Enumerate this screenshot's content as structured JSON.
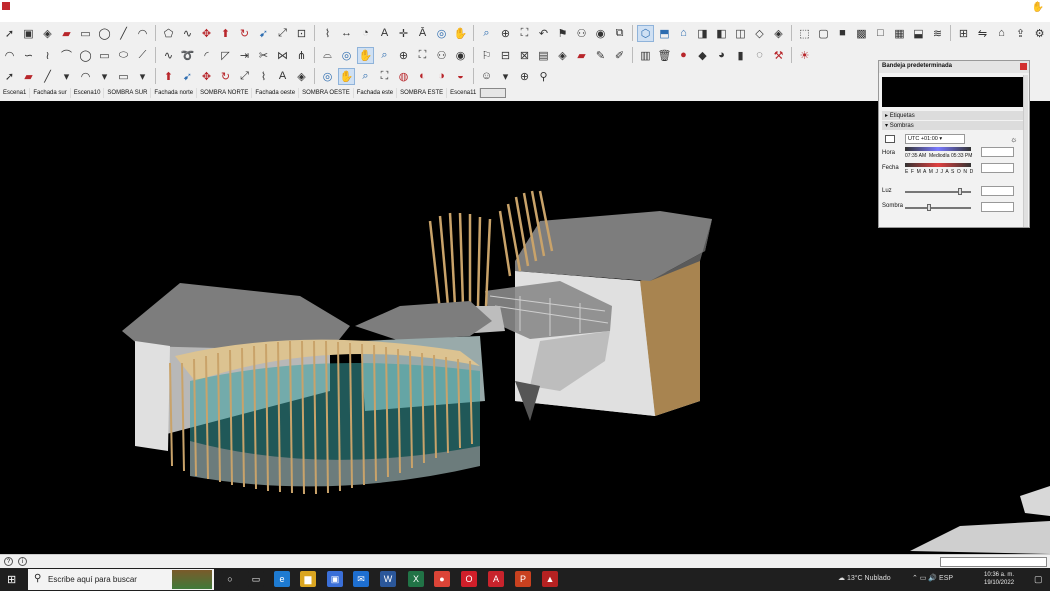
{
  "titlebar": {
    "title": "",
    "menu": "",
    "corner_icon": "hand-icon"
  },
  "toolbar1": {
    "icons": [
      "select-icon",
      "component-icon",
      "paint-icon",
      "eraser-icon",
      "rect-icon",
      "circle-icon",
      "line-icon",
      "arc-icon",
      "polygon-icon",
      "freehand-icon",
      "move-icon",
      "push-pull-icon",
      "rotate-icon",
      "follow-me-icon",
      "scale-icon",
      "offset-icon",
      "tape-icon",
      "dimension-icon",
      "protractor-icon",
      "text-icon",
      "axes-icon",
      "3d-text-icon",
      "orbit-icon",
      "pan-icon",
      "zoom-icon",
      "zoom-window-icon",
      "zoom-extents-icon",
      "previous-icon",
      "position-camera-icon",
      "walk-icon",
      "look-around-icon",
      "section-icon",
      "iso-view-icon",
      "top-view-icon",
      "front-view-icon",
      "right-view-icon",
      "back-view-icon",
      "left-view-icon",
      "xray-icon",
      "back-edges-icon",
      "wireframe-icon",
      "hidden-line-icon",
      "shaded-icon",
      "textured-icon",
      "monochrome-icon",
      "sandbox-icon",
      "stamp-icon",
      "drape-icon",
      "add-detail-icon",
      "flip-edge-icon",
      "warehouse-icon",
      "share-model-icon",
      "extension-icon"
    ]
  },
  "toolbar2": {
    "icons": [
      "arc-icon",
      "bezier-icon",
      "spline-icon",
      "curve-icon",
      "circle-icon",
      "rect-icon",
      "ellipse-icon",
      "polyline-icon",
      "wave-icon",
      "loop-icon",
      "fillet-icon",
      "chamfer-icon",
      "extend-icon",
      "trim-icon",
      "join-icon",
      "split-icon",
      "curve2-icon",
      "orbit-icon",
      "hand-icon",
      "zoom-icon",
      "zoom-window-icon",
      "zoom-extents-icon",
      "walk-icon",
      "look-around-icon",
      "position-icon",
      "section-plane-icon",
      "section-cut-icon",
      "display-icon",
      "paint-icon",
      "eraser-icon",
      "pencil-icon",
      "marker-icon",
      "layer-icon",
      "trash-icon",
      "sphere-icon",
      "shape-icon",
      "fill-icon",
      "solid-icon",
      "ghost-icon",
      "fix-icon",
      "light-icon"
    ]
  },
  "toolbar3": {
    "icons": [
      "select-icon",
      "eraser-icon",
      "line-icon",
      "dropdown-icon",
      "arc-icon",
      "dropdown-icon",
      "rect-icon",
      "dropdown-icon",
      "push-pull-icon",
      "follow-me-icon",
      "move-icon",
      "rotate-icon",
      "scale-icon",
      "tape-icon",
      "text-icon",
      "paint-icon",
      "orbit-icon",
      "pan-icon",
      "zoom-icon",
      "zoom-extents-icon",
      "scene-icon",
      "scene2-icon",
      "scene3-icon",
      "scene4-icon",
      "user-icon",
      "dropdown-icon",
      "compass-icon",
      "location-icon"
    ]
  },
  "scenes": {
    "tabs": [
      "Escena1",
      "Fachada sur",
      "Escena10",
      "SOMBRA SUR",
      "Fachada norte",
      "SOMBRA NORTE",
      "Fachada oeste",
      "SOMBRA OESTE",
      "Fachada este",
      "SOMBRA ESTE",
      "Escena11",
      ""
    ],
    "active_index": 11
  },
  "tray": {
    "title": "Bandeja predeterminada",
    "sections": [
      "Etiquetas",
      "Sombras"
    ],
    "timezone": "UTC +01:00",
    "hora_label": "Hora",
    "hora_start": "07:35 AM",
    "hora_mid": "Mediodía",
    "hora_end": "05:33 PM",
    "hora_value": "",
    "fecha_label": "Fecha",
    "months": "E F M A M J J A S O N D",
    "fecha_value": "",
    "luz_label": "Luz",
    "luz_value": "",
    "luz_level": 0.85,
    "sombra_label": "Sombra",
    "sombra_value": "",
    "sombra_level": 0.35
  },
  "taskbar": {
    "search_placeholder": "Escribe aquí para buscar",
    "weather": "13°C  Nublado",
    "language": "ESP",
    "time": "10:36 a. m.",
    "date": "19/10/2022",
    "apps": [
      {
        "name": "cortana-icon",
        "label": "○",
        "color": "#1f1f1f"
      },
      {
        "name": "task-view-icon",
        "label": "▭",
        "color": "#1f1f1f"
      },
      {
        "name": "edge-icon",
        "label": "e",
        "color": "#1e7bd1"
      },
      {
        "name": "explorer-icon",
        "label": "▆",
        "color": "#d9a520"
      },
      {
        "name": "store-icon",
        "label": "▣",
        "color": "#3a6fd8"
      },
      {
        "name": "mail-icon",
        "label": "✉",
        "color": "#1e6fd0"
      },
      {
        "name": "word-icon",
        "label": "W",
        "color": "#2b579a"
      },
      {
        "name": "excel-icon",
        "label": "X",
        "color": "#217346"
      },
      {
        "name": "chrome-icon",
        "label": "●",
        "color": "#db4437"
      },
      {
        "name": "opera-icon",
        "label": "O",
        "color": "#d01f2a"
      },
      {
        "name": "acrobat-icon",
        "label": "A",
        "color": "#c8232c"
      },
      {
        "name": "powerpoint-icon",
        "label": "P",
        "color": "#c9411f"
      },
      {
        "name": "sketchup-icon",
        "label": "▲",
        "color": "#b52222"
      }
    ]
  },
  "colors": {
    "viewport": "#000000",
    "roof": "#7d7d7d",
    "wood": "#c9a36a",
    "glass": "#3aa0a0",
    "wall": "#d9d9d9"
  }
}
